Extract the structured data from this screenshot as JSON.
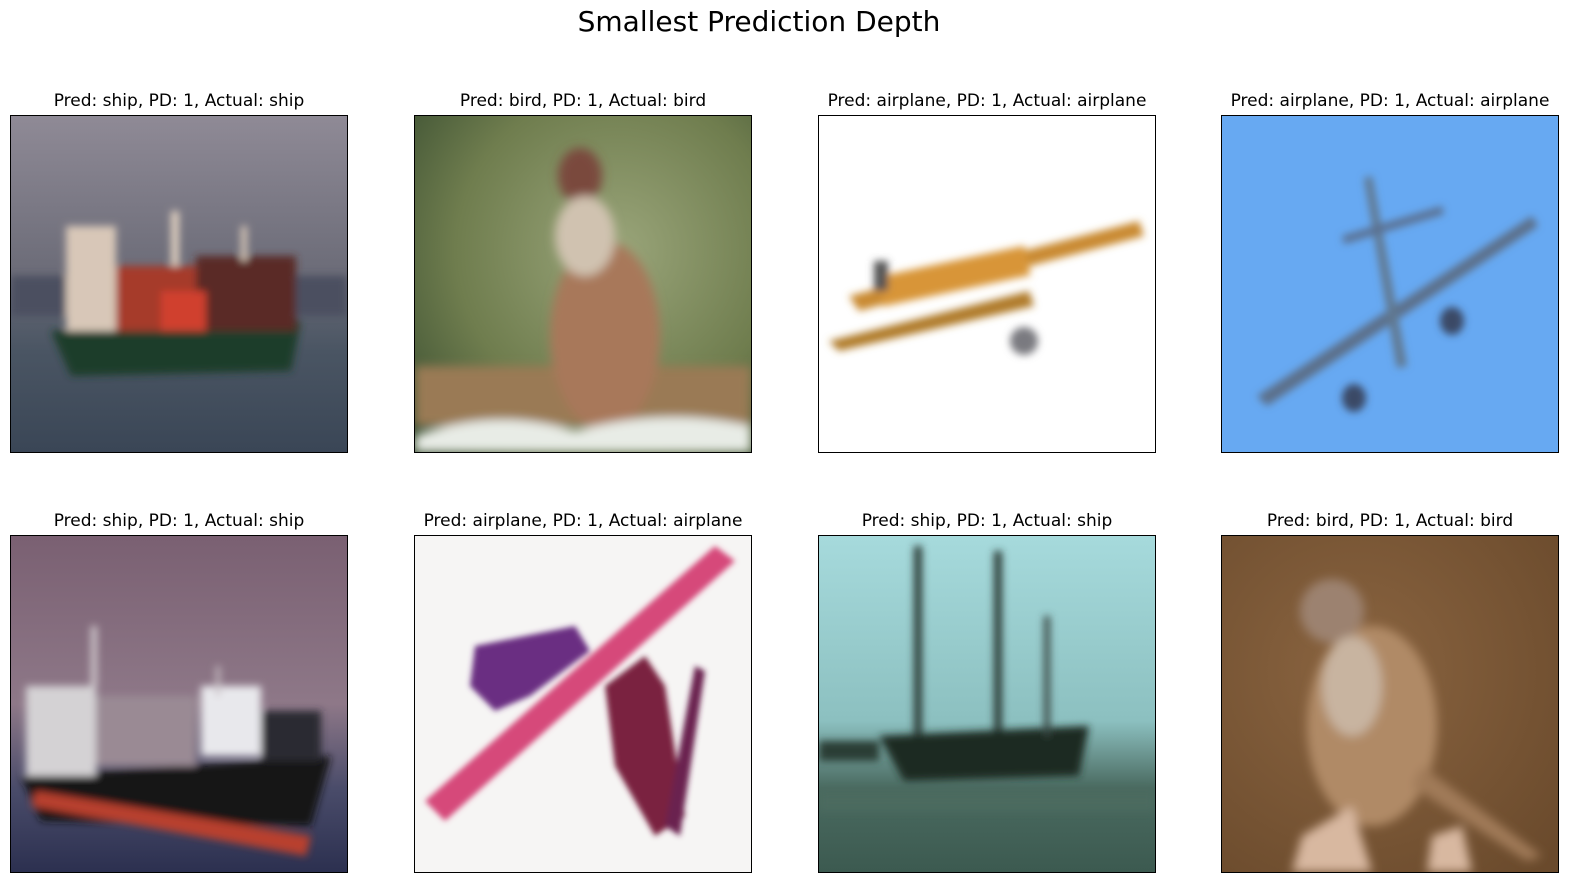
{
  "figure": {
    "title": "Smallest Prediction Depth"
  },
  "panels": [
    {
      "title": "Pred: ship, PD: 1, Actual: ship",
      "pred": "ship",
      "pd": 1,
      "actual": "ship"
    },
    {
      "title": "Pred: bird, PD: 1, Actual: bird",
      "pred": "bird",
      "pd": 1,
      "actual": "bird"
    },
    {
      "title": "Pred: airplane, PD: 1, Actual: airplane",
      "pred": "airplane",
      "pd": 1,
      "actual": "airplane"
    },
    {
      "title": "Pred: airplane, PD: 1, Actual: airplane",
      "pred": "airplane",
      "pd": 1,
      "actual": "airplane"
    },
    {
      "title": "Pred: ship, PD: 1, Actual: ship",
      "pred": "ship",
      "pd": 1,
      "actual": "ship"
    },
    {
      "title": "Pred: airplane, PD: 1, Actual: airplane",
      "pred": "airplane",
      "pd": 1,
      "actual": "airplane"
    },
    {
      "title": "Pred: ship, PD: 1, Actual: ship",
      "pred": "ship",
      "pd": 1,
      "actual": "ship"
    },
    {
      "title": "Pred: bird, PD: 1, Actual: bird",
      "pred": "bird",
      "pd": 1,
      "actual": "bird"
    }
  ],
  "colors": {
    "frame": "#000000",
    "background": "#ffffff"
  }
}
